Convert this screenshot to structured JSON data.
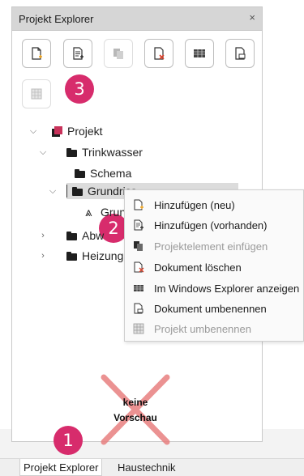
{
  "panel": {
    "title": "Projekt Explorer",
    "close_glyph": "×"
  },
  "toolbar": {
    "buttons": [
      {
        "icon": "add-new-document-icon",
        "enabled": true
      },
      {
        "icon": "add-existing-document-icon",
        "enabled": true
      },
      {
        "icon": "insert-project-element-icon",
        "enabled": false
      },
      {
        "icon": "delete-document-icon",
        "enabled": true
      },
      {
        "icon": "windows-explorer-icon",
        "enabled": true
      },
      {
        "icon": "rename-document-icon",
        "enabled": true
      },
      {
        "icon": "rename-project-icon",
        "enabled": false
      }
    ]
  },
  "badges": [
    "1",
    "2",
    "3"
  ],
  "tree": {
    "root": "Projekt",
    "trinkwasser": "Trinkwasser",
    "schema": "Schema",
    "grundriss": "Grundriss",
    "grundriss_child": "Grun",
    "abwasser": "Abw",
    "heizung": "Heizung"
  },
  "context_menu": {
    "items": [
      {
        "label": "Hinzufügen (neu)",
        "icon": "add-new-document-icon",
        "enabled": true
      },
      {
        "label": "Hinzufügen (vorhanden)",
        "icon": "add-existing-document-icon",
        "enabled": true
      },
      {
        "label": "Projektelement einfügen",
        "icon": "insert-project-element-icon",
        "enabled": false
      },
      {
        "label": "Dokument löschen",
        "icon": "delete-document-icon",
        "enabled": true
      },
      {
        "label": "Im Windows Explorer anzeigen",
        "icon": "windows-explorer-icon",
        "enabled": true
      },
      {
        "label": "Dokument umbenennen",
        "icon": "rename-document-icon",
        "enabled": true
      },
      {
        "label": "Projekt umbenennen",
        "icon": "rename-project-icon",
        "enabled": false
      }
    ]
  },
  "preview": {
    "line1": "keine",
    "line2": "Vorschau"
  },
  "tabs": [
    "Projekt Explorer",
    "Haustechnik"
  ],
  "colors": {
    "badge": "#d72c6c",
    "accent_orange": "#e8a020",
    "accent_red": "#d8402a",
    "no_preview_cross": "#e87f7f",
    "project_icon": "#c8325a"
  }
}
